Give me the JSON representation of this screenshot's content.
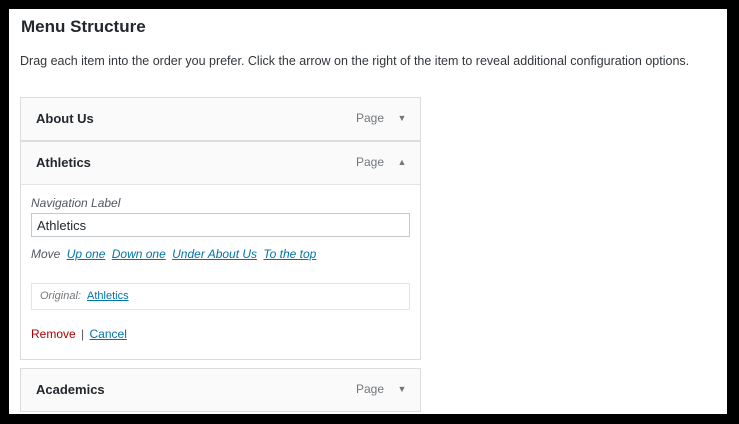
{
  "title": "Menu Structure",
  "description": "Drag each item into the order you prefer. Click the arrow on the right of the item to reveal additional configuration options.",
  "items": [
    {
      "title": "About Us",
      "type": "Page",
      "expanded": false,
      "arrow": "▼"
    },
    {
      "title": "Athletics",
      "type": "Page",
      "expanded": true,
      "arrow": "▲",
      "settings": {
        "nav_label_caption": "Navigation Label",
        "nav_label_value": "Athletics",
        "move_label": "Move",
        "move_links": [
          "Up one",
          "Down one",
          "Under About Us",
          "To the top"
        ],
        "original_label": "Original:",
        "original_link": "Athletics",
        "remove_label": "Remove",
        "separator": "|",
        "cancel_label": "Cancel"
      }
    },
    {
      "title": "Academics",
      "type": "Page",
      "expanded": false,
      "arrow": "▼"
    }
  ],
  "colors": {
    "link": "#0073aa",
    "remove": "#aa0000",
    "background": "#000000"
  }
}
